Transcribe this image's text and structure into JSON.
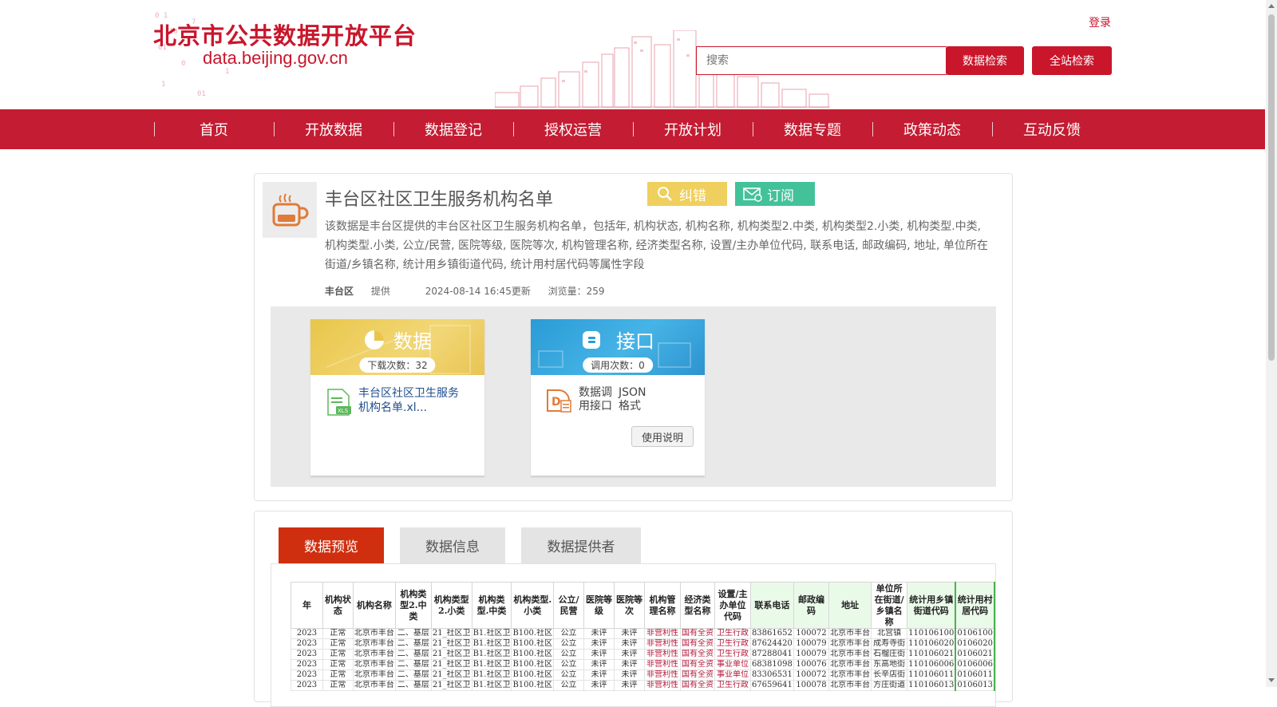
{
  "header": {
    "logo_cn": "北京市公共数据开放平台",
    "logo_en": "data.beijing.gov.cn",
    "login": "登录",
    "search_placeholder": "搜索",
    "btn_data_search": "数据检索",
    "btn_site_search": "全站检索"
  },
  "nav": {
    "items": [
      {
        "label": "首页"
      },
      {
        "label": "开放数据"
      },
      {
        "label": "数据登记"
      },
      {
        "label": "授权运营"
      },
      {
        "label": "开放计划"
      },
      {
        "label": "数据专题"
      },
      {
        "label": "政策动态"
      },
      {
        "label": "互动反馈"
      }
    ]
  },
  "dataset": {
    "title": "丰台区社区卫生服务机构名单",
    "btn_correct": "纠错",
    "btn_subscribe": "订阅",
    "description": "该数据是丰台区提供的丰台区社区卫生服务机构名单，包括年, 机构状态, 机构名称, 机构类型2.中类, 机构类型2.小类, 机构类型.中类, 机构类型.小类, 公立/民营, 医院等级, 医院等次, 机构管理名称, 经济类型名称, 设置/主办单位代码, 联系电话, 邮政编码, 地址, 单位所在街道/乡镇名称, 统计用乡镇街道代码, 统计用村居代码等属性字段",
    "provider": "丰台区",
    "provider_suffix": "提供",
    "updated": "2024-08-14 16:45更新",
    "views": "浏览量：259"
  },
  "data_card": {
    "title": "数据",
    "pill": "下载次数：32",
    "file_name": "丰台区社区卫生服务机构名单.xl..."
  },
  "api_card": {
    "title": "接口",
    "pill": "调用次数：0",
    "api_name_1": "数据调",
    "api_name_2": "用接口",
    "format_1": "JSON",
    "format_2": "格式",
    "btn_doc": "使用说明"
  },
  "tabs": [
    {
      "label": "数据预览"
    },
    {
      "label": "数据信息"
    },
    {
      "label": "数据提供者"
    }
  ],
  "preview": {
    "headers": [
      "年",
      "机构状态",
      "机构名称",
      "机构类型2.中类",
      "机构类型2.小类",
      "机构类型.中类",
      "机构类型.小类",
      "公立/民营",
      "医院等级",
      "医院等次",
      "机构管理名称",
      "经济类型名称",
      "设置/主办单位代码",
      "联系电话",
      "邮政编码",
      "地址",
      "单位所在街道/乡镇名称",
      "统计用乡镇街道代码",
      "统计用村居代码"
    ],
    "rows": [
      [
        "2023",
        "正常",
        "北京市丰台",
        "二、基层",
        "21_社区卫",
        "B1.社区卫",
        "B100.社区",
        "公立",
        "未评",
        "未评",
        "非营利性",
        "国有全资",
        "卫生行政",
        "83861652",
        "100072",
        "北京市丰台",
        "北宫镇",
        "110106100",
        "0106100"
      ],
      [
        "2023",
        "正常",
        "北京市丰台",
        "二、基层",
        "21_社区卫",
        "B1.社区卫",
        "B100.社区",
        "公立",
        "未评",
        "未评",
        "非营利性",
        "国有全资",
        "卫生行政",
        "87624420",
        "100079",
        "北京市丰台",
        "成寿寺街",
        "110106020",
        "0106020"
      ],
      [
        "2023",
        "正常",
        "北京市丰台",
        "二、基层",
        "21_社区卫",
        "B1.社区卫",
        "B100.社区",
        "公立",
        "未评",
        "未评",
        "非营利性",
        "国有全资",
        "卫生行政",
        "87288041",
        "100079",
        "北京市丰台",
        "石榴庄街",
        "110106021",
        "0106021"
      ],
      [
        "2023",
        "正常",
        "北京市丰台",
        "二、基层",
        "21_社区卫",
        "B1.社区卫",
        "B100.社区",
        "公立",
        "未评",
        "未评",
        "非营利性",
        "国有全资",
        "事业单位",
        "68381098",
        "100076",
        "北京市丰台",
        "东高地街",
        "110106006",
        "0106006"
      ],
      [
        "2023",
        "正常",
        "北京市丰台",
        "二、基层",
        "21_社区卫",
        "B1.社区卫",
        "B100.社区",
        "公立",
        "未评",
        "未评",
        "非营利性",
        "国有全资",
        "事业单位",
        "83306531",
        "100072",
        "北京市丰台",
        "长辛店街",
        "110106011",
        "0106011"
      ],
      [
        "2023",
        "正常",
        "北京市丰台",
        "二、基层",
        "21_社区卫",
        "B1.社区卫",
        "B100.社区",
        "公立",
        "未评",
        "未评",
        "非营利性",
        "国有全资",
        "卫生行政",
        "67659641",
        "100078",
        "北京市丰台",
        "方庄街道",
        "110106013",
        "0106013"
      ]
    ]
  },
  "colors": {
    "brand_red": "#c9162b",
    "nav_red": "#c41c32",
    "tab_active": "#cf2f0f",
    "correct_yellow": "#efcf5d",
    "subscribe_green": "#43c29a"
  }
}
